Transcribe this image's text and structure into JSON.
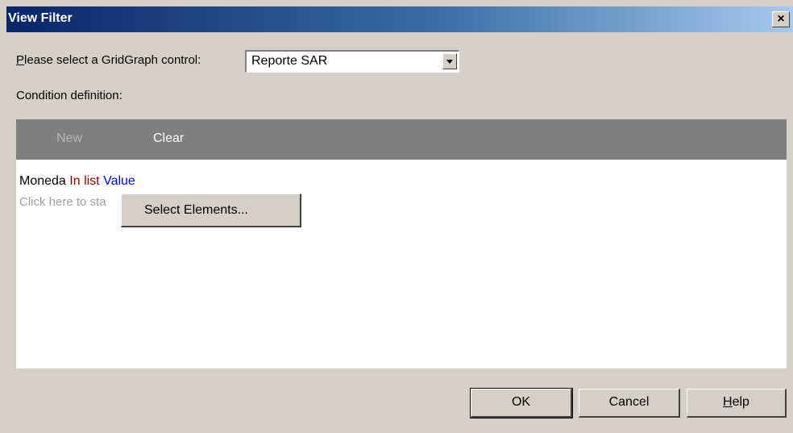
{
  "window": {
    "title": "View Filter",
    "close_label": "×"
  },
  "gridgraph": {
    "label_mnemonic": "P",
    "label_rest": "lease select a GridGraph control:",
    "selected_value": "Reporte SAR"
  },
  "condition": {
    "section_label": "Condition definition:",
    "toolbar": {
      "new_label": "New",
      "clear_label": "Clear"
    },
    "rows": [
      {
        "field": "Moneda",
        "operator": "In list",
        "value": "Value"
      }
    ],
    "hint_text": "Click here to sta"
  },
  "context_menu": {
    "item_label": "Select Elements..."
  },
  "buttons": {
    "ok_label": "OK",
    "cancel_label": "Cancel",
    "help_mnemonic": "H",
    "help_rest": "elp"
  }
}
